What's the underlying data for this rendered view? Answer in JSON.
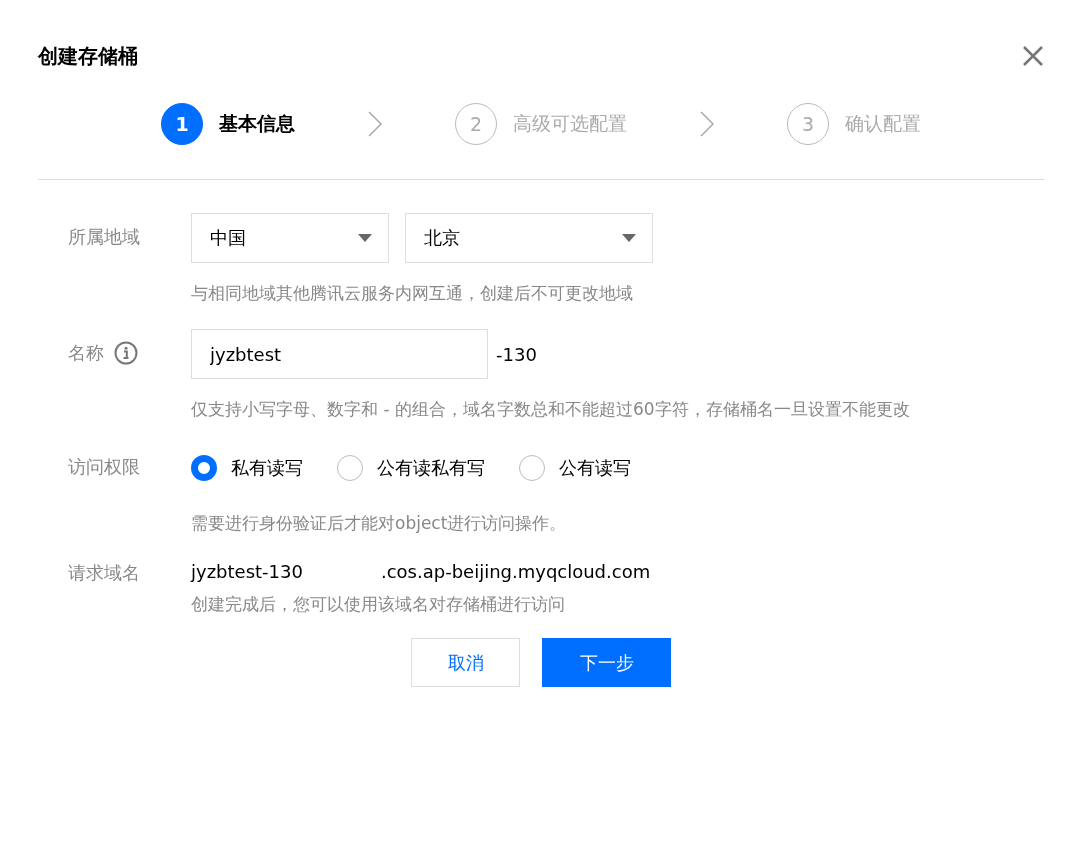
{
  "dialog": {
    "title": "创建存储桶"
  },
  "steps": [
    {
      "number": "1",
      "label": "基本信息",
      "selected": true
    },
    {
      "number": "2",
      "label": "高级可选配置",
      "selected": false
    },
    {
      "number": "3",
      "label": "确认配置",
      "selected": false
    }
  ],
  "form": {
    "region": {
      "label": "所属地域",
      "selects": [
        {
          "value": "中国"
        },
        {
          "value": "北京"
        }
      ],
      "hint": "与相同地域其他腾讯云服务内网互通，创建后不可更改地域"
    },
    "name": {
      "label": "名称",
      "value": "jyzbtest",
      "suffix": "-130",
      "hint": "仅支持小写字母、数字和 - 的组合，域名字数总和不能超过60字符，存储桶名一旦设置不能更改"
    },
    "access": {
      "label": "访问权限",
      "options": [
        {
          "label": "私有读写",
          "selected": true
        },
        {
          "label": "公有读私有写",
          "selected": false
        },
        {
          "label": "公有读写",
          "selected": false
        }
      ],
      "hint": "需要进行身份验证后才能对object进行访问操作。"
    },
    "domain": {
      "label": "请求域名",
      "parts": [
        "jyzbtest-130",
        ".cos.ap-beijing.myqcloud.com"
      ],
      "hint": "创建完成后，您可以使用该域名对存储桶进行访问"
    }
  },
  "buttons": [
    {
      "label": "取消",
      "kind": "secondary"
    },
    {
      "label": "下一步",
      "kind": "primary"
    }
  ]
}
